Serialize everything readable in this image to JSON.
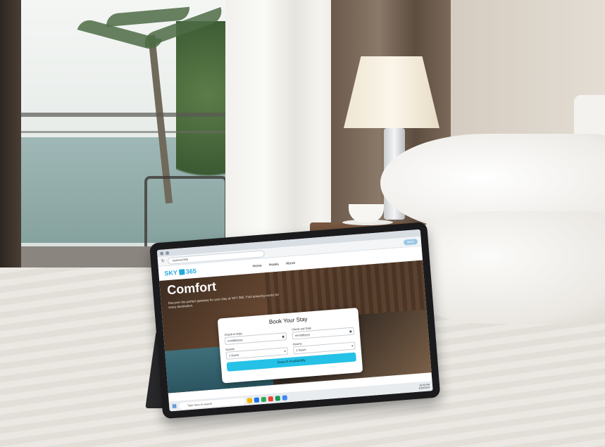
{
  "browser": {
    "url": "hyshere/365",
    "action_pill": "Book"
  },
  "site": {
    "logo_text": "SKY",
    "logo_num": "365",
    "nav": [
      "Home",
      "Hotels",
      "About"
    ]
  },
  "hero": {
    "title": "Comfort",
    "tagline": "Discover the perfect getaway for your stay at SKY 365. Find amazing rooms for every destination."
  },
  "booking": {
    "title": "Book Your Stay",
    "checkin_label": "Check-in Date",
    "checkin_value": "mm/dd/yyyy",
    "checkout_label": "Check-out Date",
    "checkout_value": "mm/dd/yyyy",
    "guests_label": "Guests",
    "guests_value": "1 Guest",
    "rooms_label": "Rooms",
    "rooms_value": "1 Room",
    "button": "Search Availability"
  },
  "taskbar": {
    "search_placeholder": "Type here to search",
    "time": "10:45 AM",
    "date": "6/18/2024"
  }
}
